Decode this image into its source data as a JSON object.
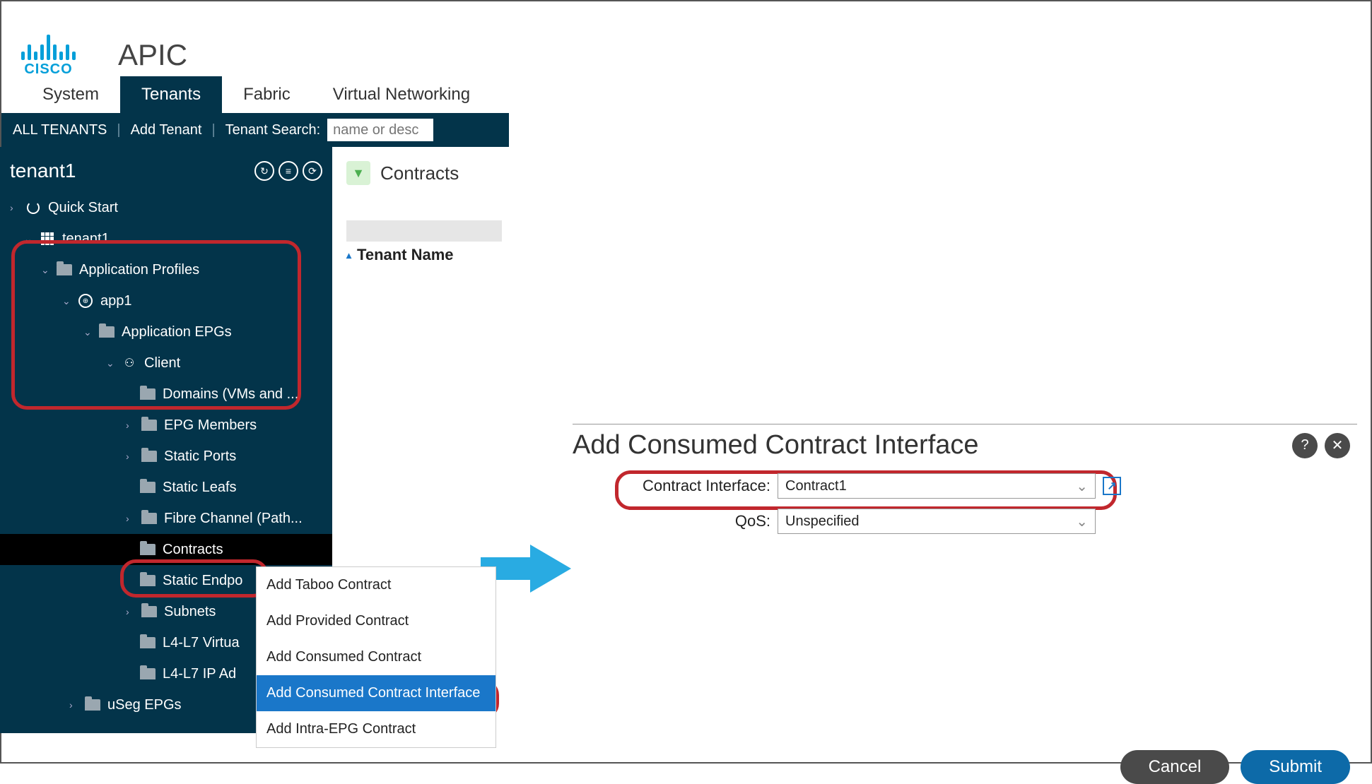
{
  "brand": {
    "vendor": "CISCO",
    "app": "APIC"
  },
  "top_tabs": {
    "system": "System",
    "tenants": "Tenants",
    "fabric": "Fabric",
    "vnet": "Virtual Networking"
  },
  "subheader": {
    "all_tenants": "ALL TENANTS",
    "add_tenant": "Add Tenant",
    "search_label": "Tenant Search:",
    "search_placeholder": "name or desc"
  },
  "tenant_title": "tenant1",
  "tree": {
    "quick_start": "Quick Start",
    "tenant1": "tenant1",
    "app_profiles": "Application Profiles",
    "app1": "app1",
    "app_epgs": "Application EPGs",
    "client": "Client",
    "domains": "Domains (VMs and ...",
    "epg_members": "EPG Members",
    "static_ports": "Static Ports",
    "static_leafs": "Static Leafs",
    "fibre_channel": "Fibre Channel (Path...",
    "contracts": "Contracts",
    "static_endpoints": "Static Endpo",
    "subnets": "Subnets",
    "l4l7_virtual": "L4-L7 Virtua",
    "l4l7_ip": "L4-L7 IP Ad",
    "useg_epgs": "uSeg EPGs"
  },
  "content": {
    "panel_title": "Contracts",
    "column_header": "Tenant Name"
  },
  "context_menu": {
    "taboo": "Add Taboo Contract",
    "provided": "Add Provided Contract",
    "consumed": "Add Consumed Contract",
    "consumed_iface": "Add Consumed Contract Interface",
    "intra_epg": "Add Intra-EPG Contract"
  },
  "dialog": {
    "title": "Add Consumed Contract Interface",
    "contract_iface_label": "Contract Interface:",
    "contract_iface_value": "Contract1",
    "qos_label": "QoS:",
    "qos_value": "Unspecified",
    "cancel": "Cancel",
    "submit": "Submit"
  }
}
